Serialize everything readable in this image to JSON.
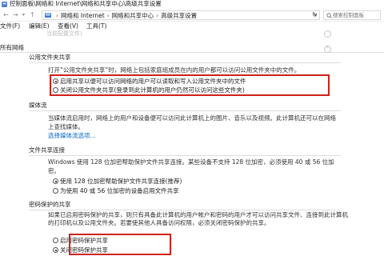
{
  "window": {
    "title": "控制面板\\网络和 Internet\\网络和共享中心\\高级共享设置"
  },
  "address": {
    "crumbs": [
      "网络和 Internet",
      "网络和共享中心",
      "高级共享设置"
    ],
    "search_placeholder": "搜索控制面板"
  },
  "menu": [
    "文件(F)",
    "编辑(E)",
    "查看(V)",
    "工具(T)"
  ],
  "faded_text": "当前配置文件)",
  "group": {
    "label": "所有网络"
  },
  "public_folder": {
    "title": "公用文件夹共享",
    "description": "打开“公用文件夹共享”时，网络上包括家庭组成员在内的用户都可以访问公用文件夹中的文件。",
    "options": [
      {
        "label": "启用共享以便可以访问网络的用户可以读取和写入公用文件夹中的文件",
        "selected": true
      },
      {
        "label": "关闭公用文件夹共享(登录到此计算机的用户仍然可以访问这些文件夹)",
        "selected": false
      }
    ]
  },
  "media": {
    "title": "媒体流",
    "description": "当媒体流启用时，网络上的用户和设备便可以访问此计算机上的图片、音乐以及视频。此计算机还可以在网络上查找媒体。",
    "link": "选择媒体流选项..."
  },
  "file_sharing": {
    "title": "文件共享连接",
    "description": "Windows 使用 128 位加密帮助保护文件共享连接。某些设备不支持 128 位加密，必须使用 40 或 56 位加密。",
    "options": [
      {
        "label": "使用 128 位加密帮助保护文件共享连接(推荐)",
        "selected": true
      },
      {
        "label": "为使用 40 或 56 位加密的设备启用文件共享",
        "selected": false
      }
    ]
  },
  "password": {
    "title": "密码保护的共享",
    "description": "如果已启用密码保护的共享，则只有具备此计算机的用户帐户和密码的用户才可以访问共享文件、连接到此计算机的打印机以及公用文件夹。若要使其他人具备访问权限，必须关闭密码保护的共享。",
    "options": [
      {
        "label": "启用密码保护共享",
        "selected": false
      },
      {
        "label": "关闭密码保护共享",
        "selected": true
      }
    ]
  },
  "colors": {
    "highlight": "#d0211c",
    "link": "#0066cc"
  }
}
